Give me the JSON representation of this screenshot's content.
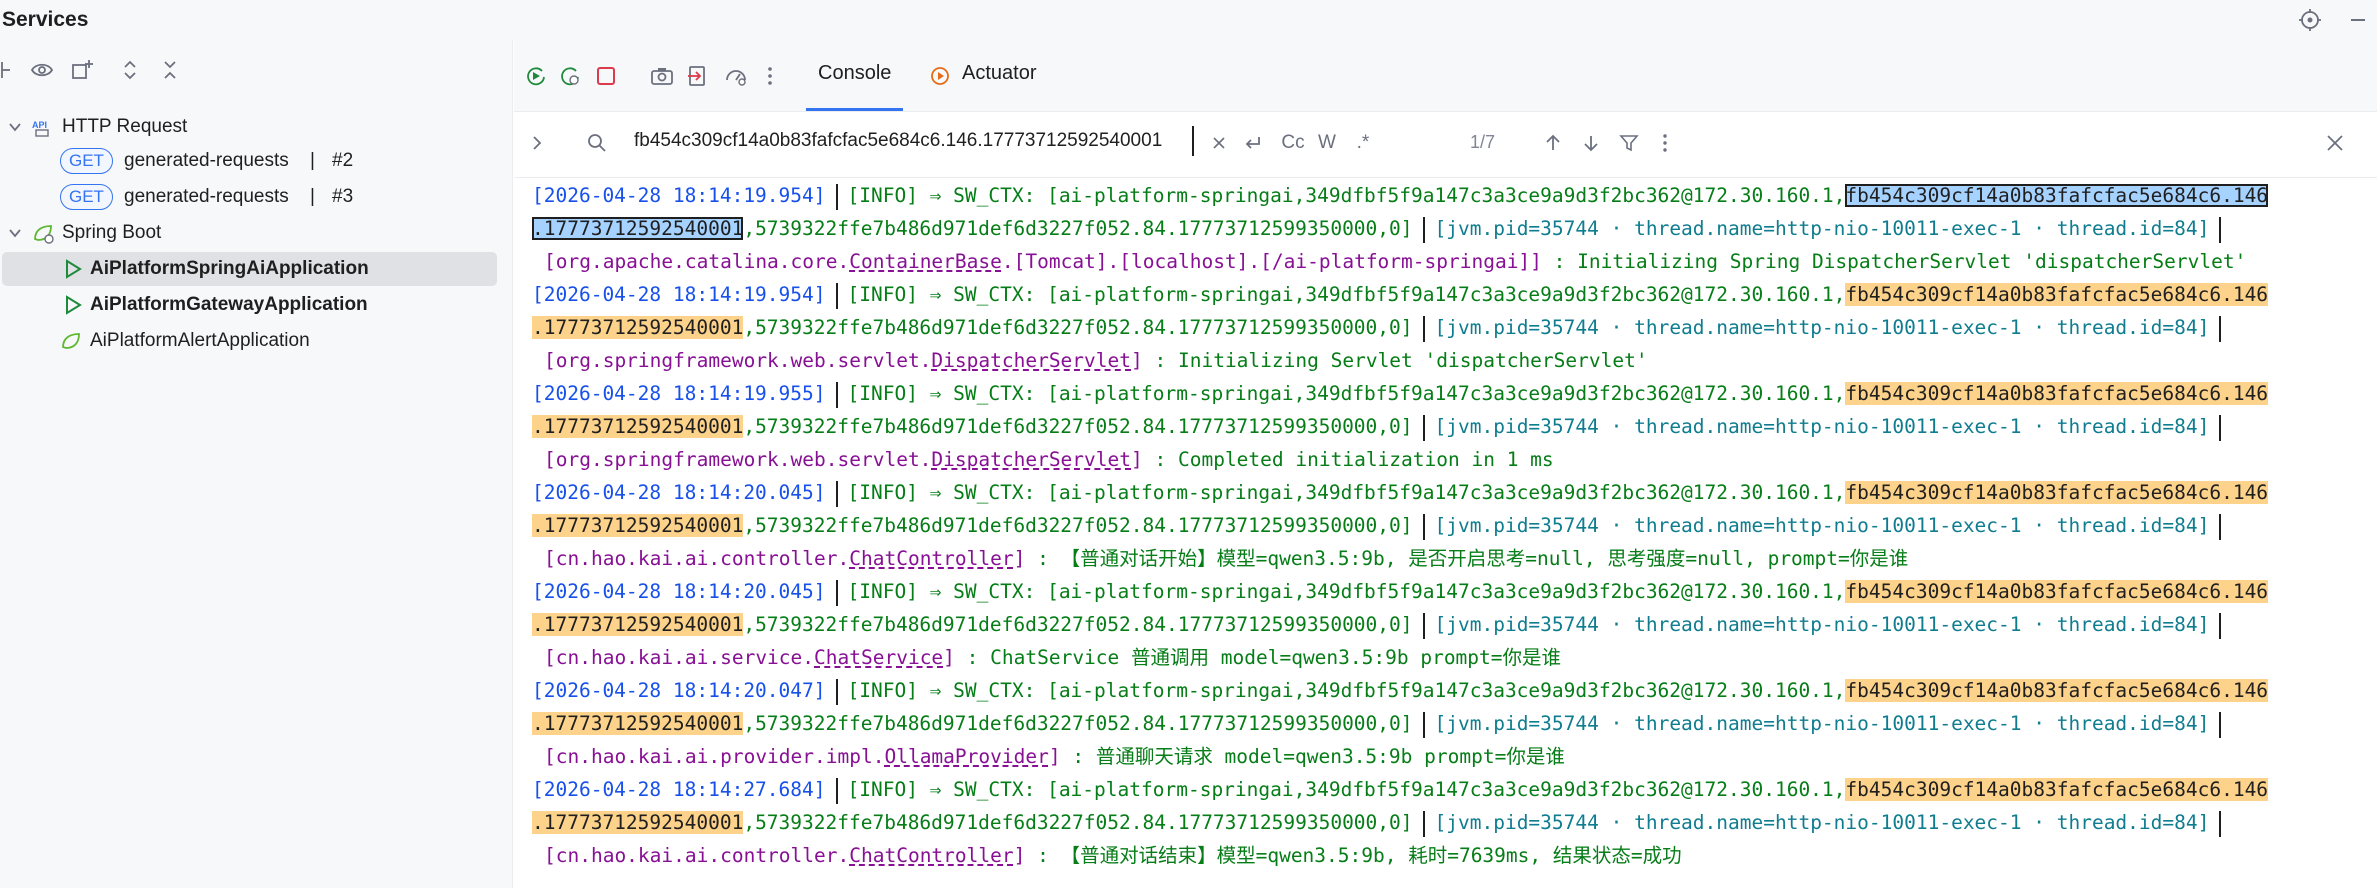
{
  "title": "Services",
  "colors": {
    "accent": "#3574f0",
    "highlight": "#fdd28a",
    "selected_highlight": "#a6d2ff"
  },
  "left_tree": {
    "http_request": "HTTP Request",
    "get1": {
      "badge": "GET",
      "label": "generated-requests",
      "sep": "|",
      "num": "#2"
    },
    "get2": {
      "badge": "GET",
      "label": "generated-requests",
      "sep": "|",
      "num": "#3"
    },
    "spring_boot": "Spring Boot",
    "apps": [
      "AiPlatformSpringAiApplication",
      "AiPlatformGatewayApplication",
      "AiPlatformAlertApplication"
    ]
  },
  "tabs": {
    "console": "Console",
    "actuator": "Actuator"
  },
  "search": {
    "query": "fb454c309cf14a0b83fafcfac5e684c6.146.17773712592540001",
    "cc": "Cc",
    "w": "W",
    "regex": ".*",
    "match_count": "1/7"
  },
  "log": {
    "sw_prefix": "[INFO] ⇒ SW_CTX: [ai-platform-springai,349dfbf5f9a147c3a3ce9a9d3f2bc362@172.30.160.1,",
    "trace_part1": "fb454c309cf14a0b83fafcfac5e684c6.146",
    "trace_part2": ".17773712592540001",
    "sw_suffix": ",5739322ffe7b486d971def6d3227f052.84.17773712599350000,0]",
    "jvm": "[jvm.pid=35744 · thread.name=http-nio-10011-exec-1 · thread.id=84]",
    "entries": [
      {
        "ts": "[2026-04-28 18:14:19.954]",
        "logger_pre": "[org.apache.catalina.core.",
        "logger_cls": "ContainerBase",
        "logger_post": ".[Tomcat].[localhost].[/ai-platform-springai]]",
        "msg": " : Initializing Spring DispatcherServlet 'dispatcherServlet'"
      },
      {
        "ts": "[2026-04-28 18:14:19.954]",
        "logger_pre": "[org.springframework.web.servlet.",
        "logger_cls": "DispatcherServlet",
        "logger_post": "]",
        "msg": " : Initializing Servlet 'dispatcherServlet'"
      },
      {
        "ts": "[2026-04-28 18:14:19.955]",
        "logger_pre": "[org.springframework.web.servlet.",
        "logger_cls": "DispatcherServlet",
        "logger_post": "]",
        "msg": " : Completed initialization in 1 ms"
      },
      {
        "ts": "[2026-04-28 18:14:20.045]",
        "logger_pre": "[cn.hao.kai.ai.controller.",
        "logger_cls": "ChatController",
        "logger_post": "]",
        "msg": " : 【普通对话开始】模型=qwen3.5:9b, 是否开启思考=null, 思考强度=null, prompt=你是谁"
      },
      {
        "ts": "[2026-04-28 18:14:20.045]",
        "logger_pre": "[cn.hao.kai.ai.service.",
        "logger_cls": "ChatService",
        "logger_post": "]",
        "msg": " : ChatService 普通调用 model=qwen3.5:9b prompt=你是谁"
      },
      {
        "ts": "[2026-04-28 18:14:20.047]",
        "logger_pre": "[cn.hao.kai.ai.provider.impl.",
        "logger_cls": "OllamaProvider",
        "logger_post": "]",
        "msg": " : 普通聊天请求 model=qwen3.5:9b prompt=你是谁"
      },
      {
        "ts": "[2026-04-28 18:14:27.684]",
        "logger_pre": "[cn.hao.kai.ai.controller.",
        "logger_cls": "ChatController",
        "logger_post": "]",
        "msg": " : 【普通对话结束】模型=qwen3.5:9b, 耗时=7639ms, 结果状态=成功"
      }
    ]
  }
}
